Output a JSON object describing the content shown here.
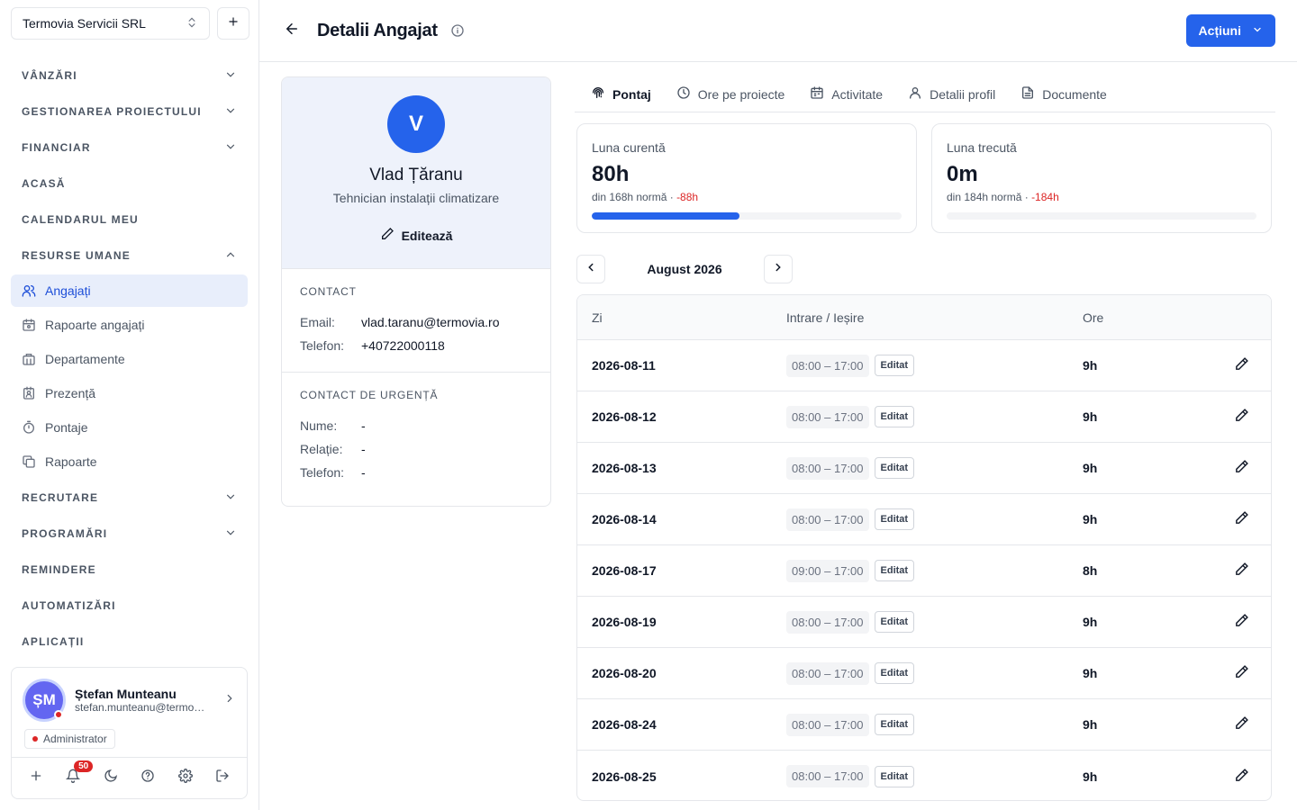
{
  "sidebar": {
    "company": "Termovia Servicii SRL",
    "sections": [
      {
        "label": "VÂNZĂRI"
      },
      {
        "label": "GESTIONAREA PROIECTULUI"
      },
      {
        "label": "FINANCIAR"
      },
      {
        "label": "ACASĂ"
      },
      {
        "label": "CALENDARUL MEU"
      },
      {
        "label": "RESURSE UMANE"
      },
      {
        "label": "RECRUTARE"
      },
      {
        "label": "PROGRAMĂRI"
      },
      {
        "label": "REMINDERE"
      },
      {
        "label": "AUTOMATIZĂRI"
      },
      {
        "label": "APLICAȚII"
      }
    ],
    "hr_items": [
      {
        "label": "Angajați",
        "icon": "users-icon"
      },
      {
        "label": "Rapoarte angajați",
        "icon": "calendar-report-icon"
      },
      {
        "label": "Departamente",
        "icon": "building-icon"
      },
      {
        "label": "Prezență",
        "icon": "badge-icon"
      },
      {
        "label": "Pontaje",
        "icon": "timer-icon"
      },
      {
        "label": "Rapoarte",
        "icon": "copy-icon"
      }
    ],
    "user": {
      "initials": "ȘM",
      "name": "Ștefan Munteanu",
      "email": "stefan.munteanu@termovia.ro",
      "role": "Administrator",
      "notifications": "50"
    }
  },
  "header": {
    "title": "Detalii Angajat",
    "actions_label": "Acțiuni"
  },
  "profile": {
    "initial": "V",
    "name": "Vlad Țăranu",
    "role": "Tehnician instalații climatizare",
    "edit_label": "Editează",
    "contact": {
      "title": "CONTACT",
      "email_label": "Email:",
      "email": "vlad.taranu@termovia.ro",
      "phone_label": "Telefon:",
      "phone": "+40722000118"
    },
    "emergency": {
      "title": "CONTACT DE URGENȚĂ",
      "name_label": "Nume:",
      "name": "-",
      "relation_label": "Relație:",
      "relation": "-",
      "phone_label": "Telefon:",
      "phone": "-"
    }
  },
  "tabs": [
    {
      "label": "Pontaj",
      "icon": "fingerprint-icon"
    },
    {
      "label": "Ore pe proiecte",
      "icon": "clock-icon"
    },
    {
      "label": "Activitate",
      "icon": "calendar-icon"
    },
    {
      "label": "Detalii profil",
      "icon": "user-icon"
    },
    {
      "label": "Documente",
      "icon": "document-icon"
    }
  ],
  "stats": {
    "current": {
      "label": "Luna curentă",
      "value": "80h",
      "sub": "din 168h normă · ",
      "diff": "-88h",
      "progress": 0.476
    },
    "previous": {
      "label": "Luna trecută",
      "value": "0m",
      "sub": "din 184h normă · ",
      "diff": "-184h",
      "progress": 0
    }
  },
  "month": "August 2026",
  "table": {
    "headers": {
      "day": "Zi",
      "inout": "Intrare / Ieșire",
      "hours": "Ore"
    },
    "rows": [
      {
        "day": "2026-08-11",
        "time": "08:00 – 17:00",
        "badge": "Editat",
        "hours": "9h"
      },
      {
        "day": "2026-08-12",
        "time": "08:00 – 17:00",
        "badge": "Editat",
        "hours": "9h"
      },
      {
        "day": "2026-08-13",
        "time": "08:00 – 17:00",
        "badge": "Editat",
        "hours": "9h"
      },
      {
        "day": "2026-08-14",
        "time": "08:00 – 17:00",
        "badge": "Editat",
        "hours": "9h"
      },
      {
        "day": "2026-08-17",
        "time": "09:00 – 17:00",
        "badge": "Editat",
        "hours": "8h"
      },
      {
        "day": "2026-08-19",
        "time": "08:00 – 17:00",
        "badge": "Editat",
        "hours": "9h"
      },
      {
        "day": "2026-08-20",
        "time": "08:00 – 17:00",
        "badge": "Editat",
        "hours": "9h"
      },
      {
        "day": "2026-08-24",
        "time": "08:00 – 17:00",
        "badge": "Editat",
        "hours": "9h"
      },
      {
        "day": "2026-08-25",
        "time": "08:00 – 17:00",
        "badge": "Editat",
        "hours": "9h"
      }
    ]
  },
  "colors": {
    "accent": "#2563eb",
    "negative": "#dc2626",
    "active_nav_bg": "#e8eefb"
  }
}
